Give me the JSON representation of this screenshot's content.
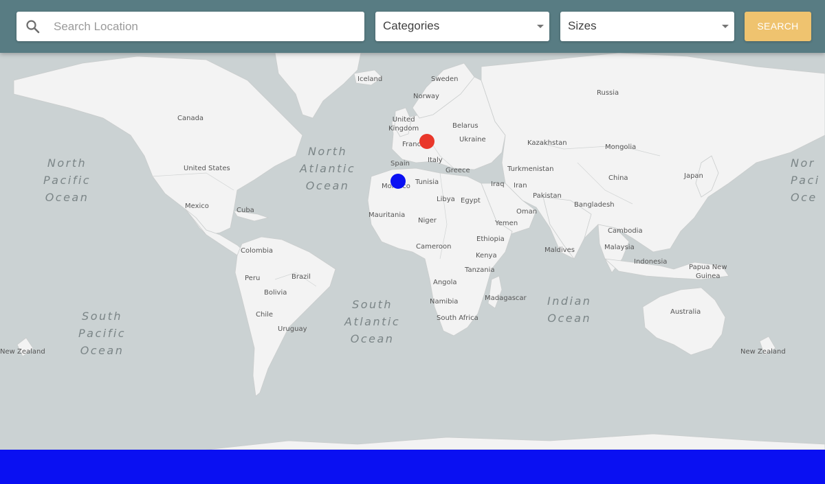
{
  "search": {
    "placeholder": "Search Location",
    "icon": "search-icon"
  },
  "filters": {
    "categories_label": "Categories",
    "sizes_label": "Sizes"
  },
  "search_button_label": "SEARCH",
  "colors": {
    "topbar": "#587c83",
    "search_button": "#efc36f",
    "marker_red": "#e9372a",
    "marker_blue": "#0a10f2",
    "bottom_bar": "#0a10f2",
    "land": "#f3f3f3",
    "water": "#cbd2d3"
  },
  "map": {
    "oceans": {
      "north_pacific_left": "North\nPacific\nOcean",
      "north_atlantic": "North\nAtlantic\nOcean",
      "south_atlantic": "South\nAtlantic\nOcean",
      "south_pacific": "South\nPacific\nOcean",
      "indian": "Indian\nOcean",
      "north_pacific_right": "Nor\nPaci\nOce"
    },
    "labels": {
      "iceland": "Iceland",
      "sweden": "Sweden",
      "norway": "Norway",
      "russia": "Russia",
      "united_kingdom": "United\nKingdom",
      "belarus": "Belarus",
      "canada": "Canada",
      "france": "France",
      "ukraine": "Ukraine",
      "kazakhstan": "Kazakhstan",
      "mongolia": "Mongolia",
      "united_states": "United States",
      "spain": "Spain",
      "italy": "Italy",
      "greece": "Greece",
      "turkmenistan": "Turkmenistan",
      "japan": "Japan",
      "morocco": "Morocco",
      "tunisia": "Tunisia",
      "iraq": "Iraq",
      "iran": "Iran",
      "china": "China",
      "mexico": "Mexico",
      "libya": "Libya",
      "egypt": "Egypt",
      "pakistan": "Pakistan",
      "cuba": "Cuba",
      "bangladesh": "Bangladesh",
      "mauritania": "Mauritania",
      "niger": "Niger",
      "oman": "Oman",
      "yemen": "Yemen",
      "cambodia": "Cambodia",
      "colombia": "Colombia",
      "cameroon": "Cameroon",
      "ethiopia": "Ethiopia",
      "maldives": "Maldives",
      "malaysia": "Malaysia",
      "kenya": "Kenya",
      "indonesia": "Indonesia",
      "papua_new_guinea": "Papua New\nGuinea",
      "peru": "Peru",
      "brazil": "Brazil",
      "tanzania": "Tanzania",
      "bolivia": "Bolivia",
      "angola": "Angola",
      "madagascar": "Madagascar",
      "namibia": "Namibia",
      "chile": "Chile",
      "australia": "Australia",
      "south_africa": "South Africa",
      "uruguay": "Uruguay",
      "new_zealand_left": "New Zealand",
      "new_zealand_right": "New Zealand"
    }
  }
}
